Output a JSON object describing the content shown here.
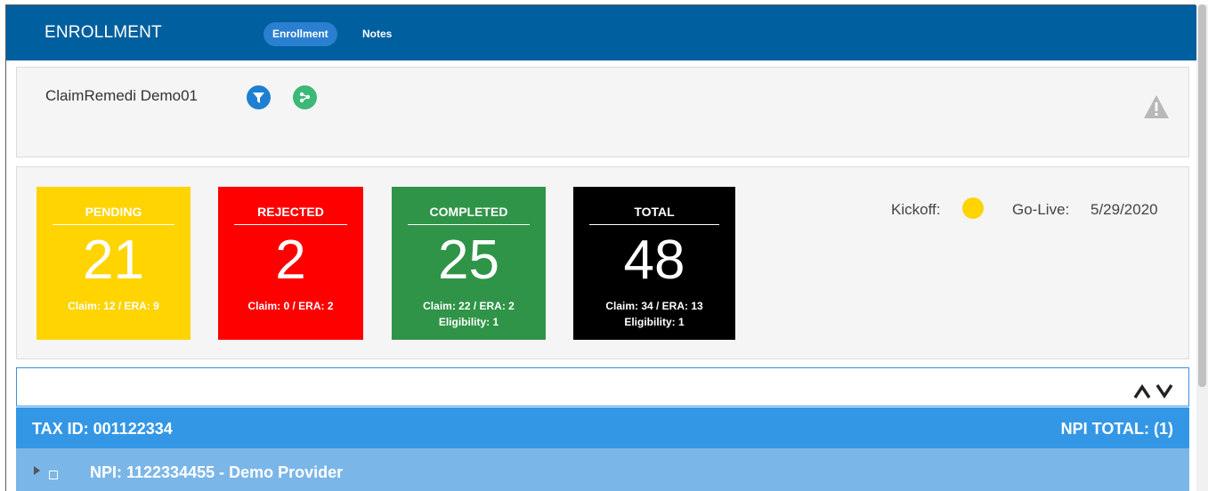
{
  "header": {
    "title": "ENROLLMENT",
    "tabs": [
      {
        "label": "Enrollment",
        "active": true
      },
      {
        "label": "Notes",
        "active": false
      }
    ]
  },
  "client": {
    "name": "ClaimRemedi Demo01",
    "icons": [
      "filter-icon",
      "network-icon",
      "warning-icon"
    ]
  },
  "stats": {
    "cards": [
      {
        "title": "PENDING",
        "count": "21",
        "line1": "Claim: 12 / ERA: 9",
        "line2": "",
        "color": "#ffd400"
      },
      {
        "title": "REJECTED",
        "count": "2",
        "line1": "Claim: 0 / ERA: 2",
        "line2": "",
        "color": "#ff0000"
      },
      {
        "title": "COMPLETED",
        "count": "25",
        "line1": "Claim: 22 / ERA: 2",
        "line2": "Eligibility: 1",
        "color": "#2f9447"
      },
      {
        "title": "TOTAL",
        "count": "48",
        "line1": "Claim: 34 / ERA: 13",
        "line2": "Eligibility: 1",
        "color": "#000000"
      }
    ],
    "kickoff_label": "Kickoff:",
    "kickoff_status_color": "#ffd400",
    "golive_label": "Go-Live:",
    "golive_date": "5/29/2020"
  },
  "tax": {
    "label": "TAX ID: 001122334",
    "npi_total": "NPI TOTAL: (1)"
  },
  "npi_rows": [
    {
      "label": "NPI: 1122334455 - Demo Provider"
    }
  ],
  "colors": {
    "header": "#005f9e",
    "tax_bar": "#3397e6",
    "npi_row": "#7bb6e8"
  }
}
